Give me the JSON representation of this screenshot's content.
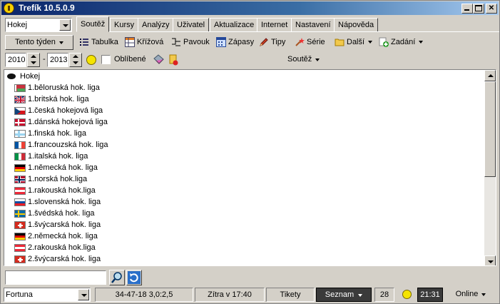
{
  "window": {
    "title": "Trefík 10.5.0.9"
  },
  "sport_select": {
    "value": "Hokej"
  },
  "week_button": {
    "label": "Tento týden"
  },
  "tabs": [
    {
      "label": "Soutěž",
      "active": true
    },
    {
      "label": "Kursy"
    },
    {
      "label": "Analýzy"
    },
    {
      "label": "Uživatel"
    },
    {
      "label": "Aktualizace"
    },
    {
      "label": "Internet"
    },
    {
      "label": "Nastavení"
    },
    {
      "label": "Nápověda"
    }
  ],
  "toolbar": {
    "tabulka": "Tabulka",
    "krizova": "Křížová",
    "pavouk": "Pavouk",
    "zapasy": "Zápasy",
    "tipy": "Tipy",
    "serie": "Série",
    "dalsi": "Další",
    "zadani": "Zadání"
  },
  "filter": {
    "year_from": "2010",
    "year_to": "2013",
    "separator": "-",
    "favorites_label": "Oblíbené",
    "favorites_checked": false,
    "competition_menu": "Soutěž"
  },
  "tree": {
    "root": "Hokej",
    "items": [
      {
        "label": "1.běloruská hok. liga",
        "flag": "by"
      },
      {
        "label": "1.britská hok. liga",
        "flag": "gb"
      },
      {
        "label": "1.česká hokejová liga",
        "flag": "cz"
      },
      {
        "label": "1.dánská hokejová liga",
        "flag": "dk"
      },
      {
        "label": "1.finská hok. liga",
        "flag": "fi"
      },
      {
        "label": "1.francouzská hok. liga",
        "flag": "fr"
      },
      {
        "label": "1.italská hok. liga",
        "flag": "it"
      },
      {
        "label": "1.německá hok. liga",
        "flag": "de"
      },
      {
        "label": "1.norská hok.liga",
        "flag": "no"
      },
      {
        "label": "1.rakouská hok.liga",
        "flag": "at"
      },
      {
        "label": "1.slovenská hok. liga",
        "flag": "sk"
      },
      {
        "label": "1.švédská hok. liga",
        "flag": "se"
      },
      {
        "label": "1.švýcarská hok. liga",
        "flag": "ch"
      },
      {
        "label": "2.německá hok. liga",
        "flag": "de"
      },
      {
        "label": "2.rakouská hok.liga",
        "flag": "at"
      },
      {
        "label": "2.švýcarská hok. liga",
        "flag": "ch"
      }
    ]
  },
  "search": {
    "value": ""
  },
  "status": {
    "bookmaker": "Fortuna",
    "record": "34-47-18  3,0:2,5",
    "next_update": "Zítra v 17:40",
    "tickets": "Tikety",
    "list_menu": "Seznam",
    "count": "28",
    "time": "21:31",
    "online": "Online"
  },
  "colors": {
    "titlebar_start": "#0a246a",
    "face": "#d4d0c8",
    "dark_status": "#3a3a3a"
  }
}
